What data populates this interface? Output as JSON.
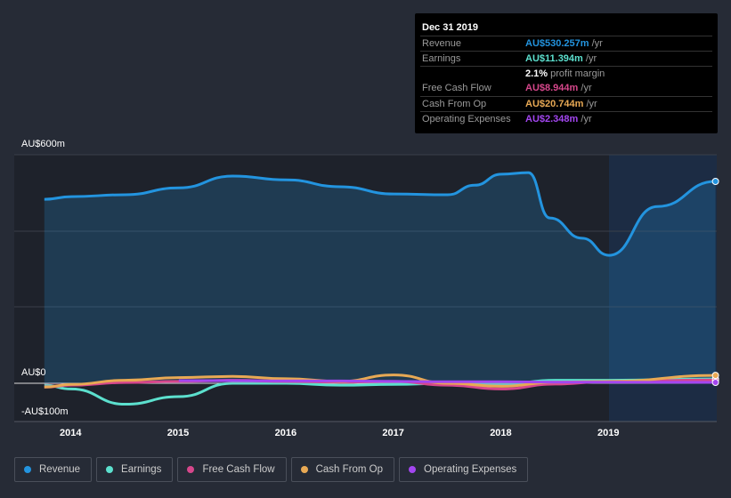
{
  "tooltip": {
    "date": "Dec 31 2019",
    "rows": [
      {
        "label": "Revenue",
        "value": "AU$530.257m",
        "unit": " /yr",
        "color": "#2394df"
      },
      {
        "label": "Earnings",
        "value": "AU$11.394m",
        "unit": " /yr",
        "color": "#5ce0ce"
      },
      {
        "label": "",
        "value": "2.1%",
        "unit": " profit margin",
        "color": "#ffffff"
      },
      {
        "label": "Free Cash Flow",
        "value": "AU$8.944m",
        "unit": " /yr",
        "color": "#d6478b"
      },
      {
        "label": "Cash From Op",
        "value": "AU$20.744m",
        "unit": " /yr",
        "color": "#e8a954"
      },
      {
        "label": "Operating Expenses",
        "value": "AU$2.348m",
        "unit": " /yr",
        "color": "#a346f0"
      }
    ]
  },
  "chart_data": {
    "type": "line",
    "ylim": [
      -100,
      600
    ],
    "y_tick_labels": [
      "AU$600m",
      "AU$0",
      "-AU$100m"
    ],
    "x_tick_labels": [
      "2014",
      "2015",
      "2016",
      "2017",
      "2018",
      "2019"
    ],
    "legend_position": "bottom",
    "forecast_shaded_from": 2019,
    "x": [
      2013.75,
      2014,
      2014.5,
      2015,
      2015.5,
      2016,
      2016.5,
      2017,
      2017.5,
      2018,
      2018.5,
      2019,
      2019.99
    ],
    "series": [
      {
        "name": "Revenue",
        "color": "#2394df",
        "x": [
          2013.75,
          2014,
          2014.5,
          2015,
          2015.5,
          2016,
          2016.5,
          2017,
          2017.5,
          2017.75,
          2018,
          2018.25,
          2018.45,
          2018.75,
          2019,
          2019.45,
          2019.99
        ],
        "values": [
          483,
          490,
          495,
          513,
          544,
          534,
          516,
          497,
          495,
          520,
          549,
          553,
          434,
          381,
          336,
          464,
          530
        ]
      },
      {
        "name": "Earnings",
        "color": "#5ce0ce",
        "values": [
          -5,
          -15,
          -55,
          -35,
          0,
          0,
          -5,
          -3,
          0,
          -2,
          8,
          8,
          11.4
        ]
      },
      {
        "name": "Free Cash Flow",
        "color": "#d6478b",
        "values": [
          -10,
          -5,
          2,
          5,
          8,
          5,
          3,
          5,
          -5,
          -15,
          -2,
          5,
          8.9
        ]
      },
      {
        "name": "Cash From Op",
        "color": "#e8a954",
        "values": [
          -10,
          -3,
          8,
          15,
          18,
          12,
          5,
          22,
          0,
          -8,
          3,
          5,
          20.7
        ]
      },
      {
        "name": "Operating Expenses",
        "color": "#a346f0",
        "x": [
          2015,
          2015.5,
          2016,
          2016.5,
          2017,
          2017.5,
          2018,
          2018.5,
          2019,
          2019.99
        ],
        "values": [
          7,
          7,
          6,
          6,
          5,
          4,
          4,
          3,
          3,
          2.3
        ]
      }
    ]
  }
}
